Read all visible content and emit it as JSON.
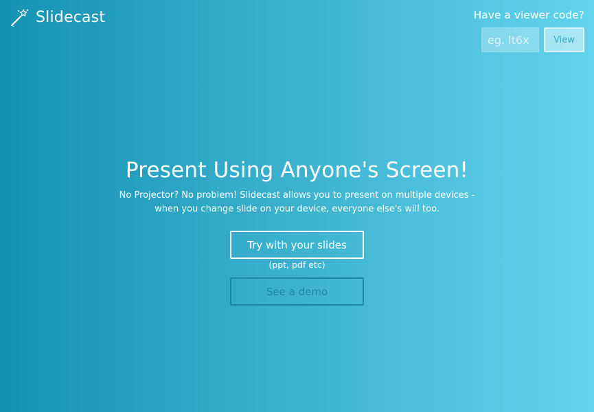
{
  "brand": {
    "name": "Slidecast",
    "icon": "magic-wand-icon"
  },
  "viewer": {
    "label": "Have a viewer code?",
    "input_placeholder": "eg. lt6x",
    "button_label": "View"
  },
  "hero": {
    "title": "Present Using Anyone's Screen!",
    "description": "No Projector? No problem! Slidecast allows you to present on multiple devices - when you change slide on your device, everyone else's will too.",
    "try_label": "Try with your slides",
    "try_note": "(ppt, pdf etc)",
    "demo_label": "See a demo"
  },
  "colors": {
    "gradient_start": "#1592b3",
    "gradient_end": "#63d4ee",
    "demo_accent": "#1d86a6"
  }
}
